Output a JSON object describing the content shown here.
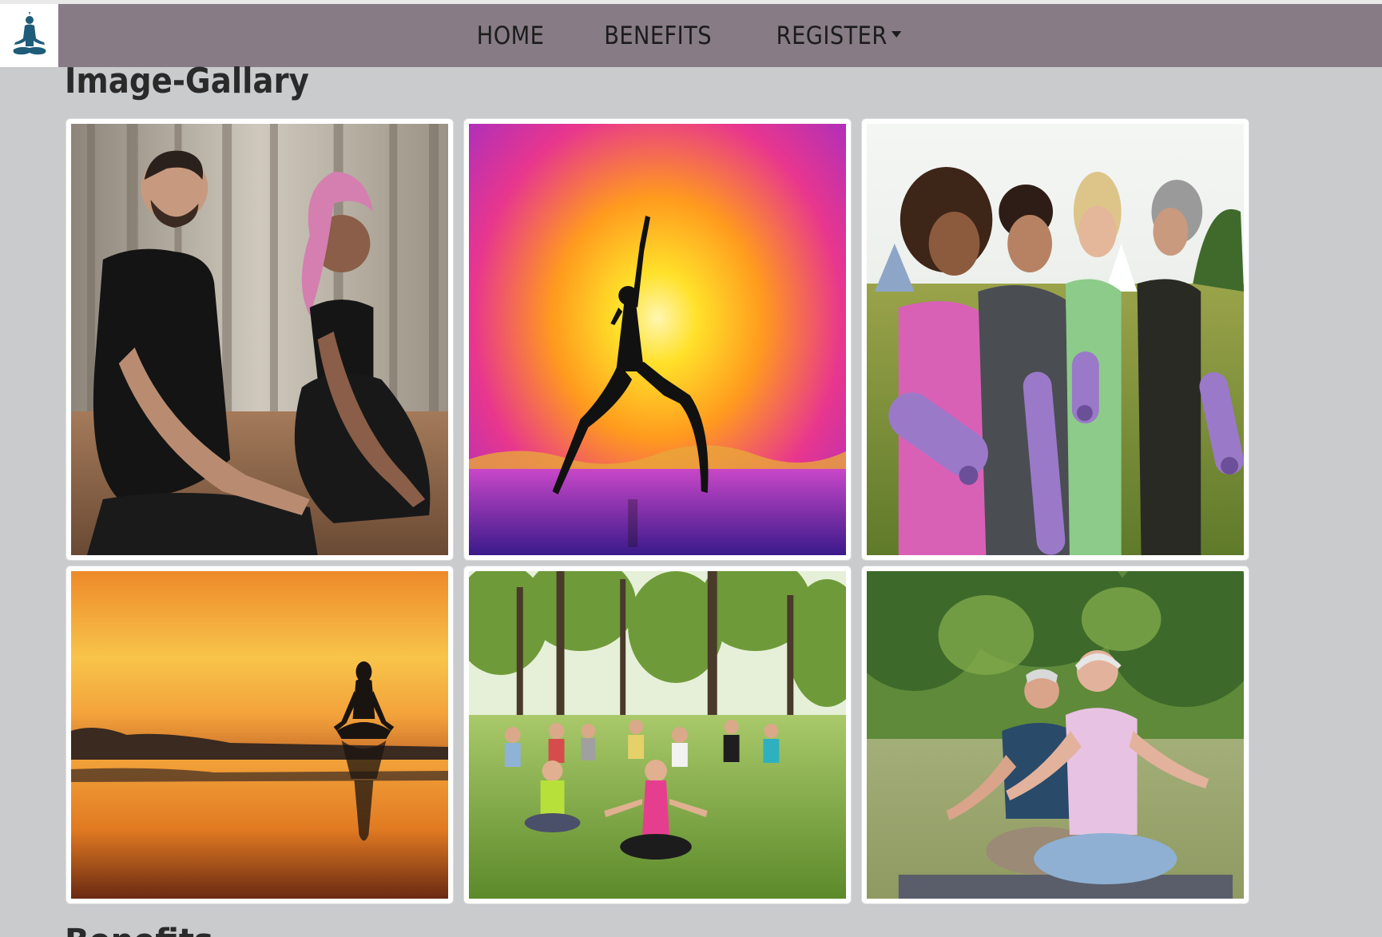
{
  "nav": {
    "logo_icon": "meditation-icon",
    "items": [
      {
        "label": "HOME"
      },
      {
        "label": "BENEFITS"
      },
      {
        "label": "REGISTER",
        "has_dropdown": true
      }
    ]
  },
  "page": {
    "title": "Image-Gallary",
    "next_section": "Benefits"
  },
  "gallery": {
    "images": [
      {
        "name": "meditating-couple-photo"
      },
      {
        "name": "sunset-warrior-pose-photo"
      },
      {
        "name": "women-with-yoga-mats-photo"
      },
      {
        "name": "sunset-lake-meditation-photo"
      },
      {
        "name": "park-group-yoga-photo"
      },
      {
        "name": "seniors-meditating-photo"
      }
    ]
  },
  "colors": {
    "navbar": "#877b85",
    "background": "#c9cbcd",
    "logo": "#1e5c7a"
  }
}
